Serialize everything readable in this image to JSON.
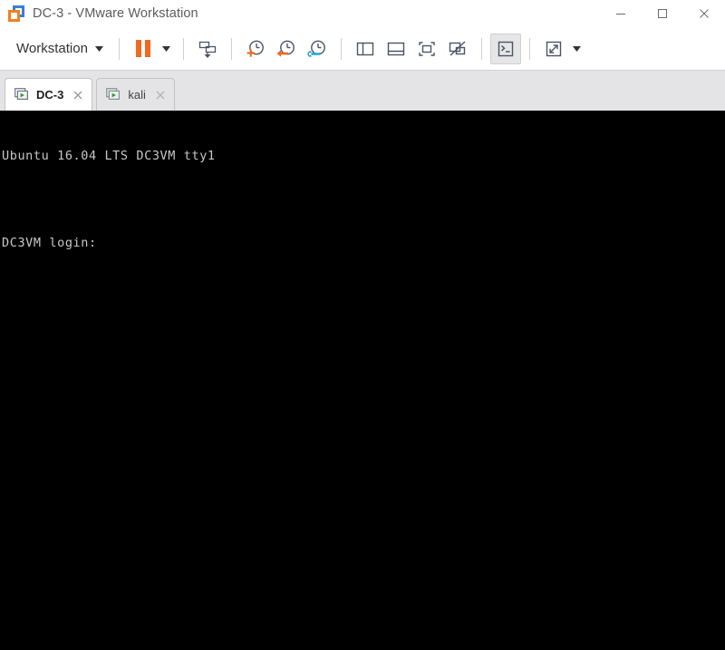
{
  "window": {
    "title": "DC-3 - VMware Workstation",
    "app_icon": "vmware-logo-icon",
    "controls": {
      "minimize_label": "Minimize",
      "maximize_label": "Maximize",
      "close_label": "Close"
    }
  },
  "toolbar": {
    "menu_label": "Workstation",
    "menu_caret": "chevron-down-icon",
    "buttons": [
      {
        "name": "pause-vm",
        "label": "Pause",
        "icon": "pause-icon"
      },
      {
        "name": "pause-dropdown",
        "label": "Power options",
        "icon": "chevron-down-icon"
      },
      {
        "name": "send-ctrl-alt-del",
        "label": "Send Ctrl+Alt+Del",
        "icon": "send-keys-icon"
      },
      {
        "name": "take-snapshot",
        "label": "Take snapshot of this virtual machine",
        "icon": "clock-plus-icon"
      },
      {
        "name": "revert-snapshot",
        "label": "Revert this virtual machine to its parent snapshot",
        "icon": "clock-back-arrow-icon"
      },
      {
        "name": "manage-snapshots",
        "label": "Manage snapshots for this virtual machine",
        "icon": "clock-wrench-icon"
      },
      {
        "name": "show-library",
        "label": "Show or hide the Library",
        "icon": "panel-left-icon"
      },
      {
        "name": "show-thumbnails",
        "label": "Show or hide thumbnail bar",
        "icon": "panel-bottom-icon"
      },
      {
        "name": "enter-fullscreen",
        "label": "Enter full screen mode",
        "icon": "fullscreen-icon"
      },
      {
        "name": "unity-mode",
        "label": "Unity mode",
        "icon": "unity-disabled-icon"
      },
      {
        "name": "console-view",
        "label": "Console view",
        "icon": "terminal-icon",
        "pressed": true
      },
      {
        "name": "stretch-guest",
        "label": "Stretch guest display",
        "icon": "stretch-icon"
      },
      {
        "name": "stretch-dropdown",
        "label": "Display options",
        "icon": "chevron-down-icon"
      }
    ]
  },
  "tabs": [
    {
      "name": "tab-dc-3",
      "label": "DC-3",
      "icon": "vm-running-icon",
      "active": true,
      "close_icon": "close-icon"
    },
    {
      "name": "tab-kali",
      "label": "kali",
      "icon": "vm-running-icon",
      "active": false,
      "close_icon": "close-icon"
    }
  ],
  "console": {
    "lines": [
      "Ubuntu 16.04 LTS DC3VM tty1",
      "",
      "DC3VM login:"
    ],
    "background_color": "#000000",
    "text_color": "#c8c8c8"
  },
  "colors": {
    "accent_orange": "#f26722",
    "accent_blue": "#3a7fd5",
    "accent_cyan": "#29a8d8",
    "icon_gray": "#4a5568",
    "tabstrip_bg": "#e4e4e6",
    "titlebar_text": "#5c5c5c"
  }
}
